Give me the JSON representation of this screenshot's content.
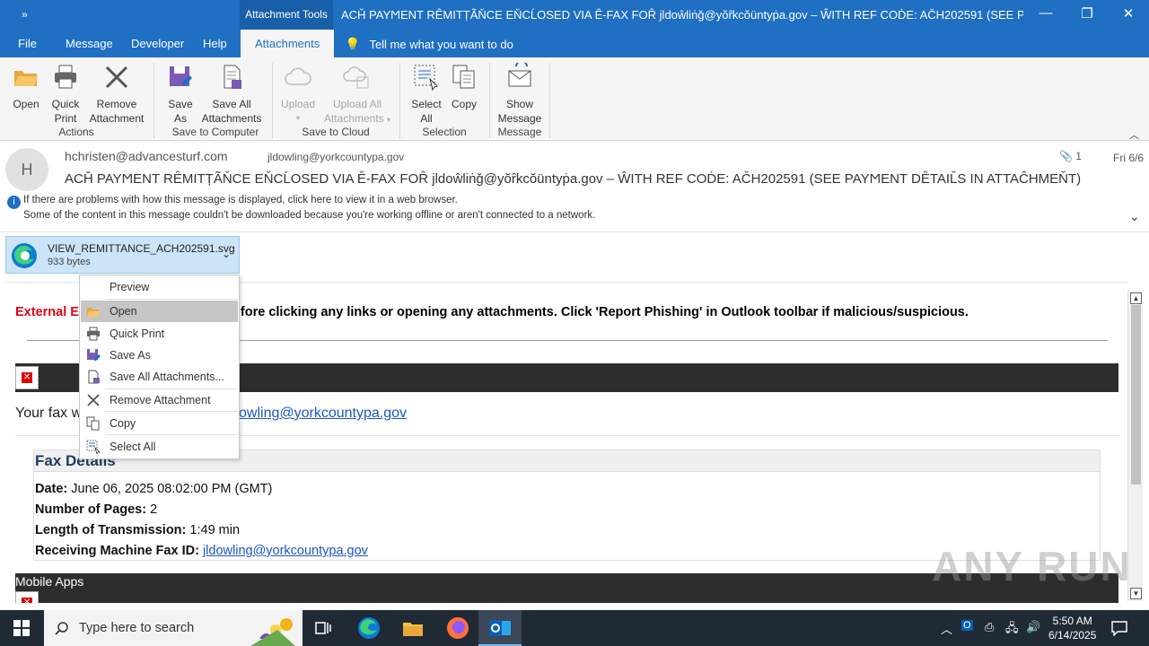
{
  "titlebar": {
    "quick_access": "»",
    "tool_tab": "Attachment Tools",
    "title": "ACȞ PAYϺENT RȆMITȚÃN̆CE EN̆CĹOSED VIA Ȇ-FAX FOȒ jldoŵliṅǧ@yŏȓkcŏüntyṗa.gov – ŴITH REF COḊE: AC̆H202591 (SEE PAYϺENT DȆTAIL̆S IN ATTAĈHMEN̆T)",
    "title_visible": "ACȞ PAYϺENT RȆMITȚÃN̆CE EN̆CĹOSED VIA Ȇ-FAX FOȒ jldoŵliṅǧ@yŏȓkcŏüntyṗa.gov – ŴITH REF COḊE: AC̆H202591 (SEE PAYϺENT DȆTAIL...",
    "minimize": "—",
    "restore": "❐",
    "close": "✕"
  },
  "tabs": {
    "file": "File",
    "message": "Message",
    "developer": "Developer",
    "help": "Help",
    "attachments": "Attachments",
    "tell_me": "Tell me what you want to do"
  },
  "ribbon": {
    "open": "Open",
    "quick_print_1": "Quick",
    "quick_print_2": "Print",
    "remove_1": "Remove",
    "remove_2": "Attachment",
    "group_actions": "Actions",
    "save_as_1": "Save",
    "save_as_2": "As",
    "save_all_1": "Save All",
    "save_all_2": "Attachments",
    "group_save_computer": "Save to Computer",
    "upload": "Upload",
    "upload_all_1": "Upload All",
    "upload_all_2": "Attachments",
    "group_save_cloud": "Save to Cloud",
    "select_all_1": "Select",
    "select_all_2": "All",
    "copy": "Copy",
    "group_selection": "Selection",
    "show_msg_1": "Show",
    "show_msg_2": "Message",
    "group_message": "Message"
  },
  "header": {
    "avatar_letter": "H",
    "from": "hchristen@advancesturf.com",
    "to": "jldowling@yorkcountypa.gov",
    "attachment_count": "1",
    "date": "Fri 6/6",
    "subject": "ACȞ PAYϺENT RȆMITȚÃN̆CE EN̆CĹOSED VIA Ȇ-FAX FOȒ jldoŵliṅǧ@yŏȓkcŏüntyṗa.gov – ŴITH REF COḊE: AC̆H202591 (SEE PAYϺENT DȆTAIL̆S IN ATTAĈHMEN̆T)",
    "info_line1": "If there are problems with how this message is displayed, click here to view it in a web browser.",
    "info_line2": "Some of the content in this message couldn't be downloaded because you're working offline or aren't connected to a network."
  },
  "attachment": {
    "name": "VIEW_REMITTANCE_ACH202591.svg",
    "size": "933 bytes"
  },
  "context_menu": {
    "preview": "Preview",
    "open": "Open",
    "quick_print": "Quick Print",
    "save_as": "Save As",
    "save_all": "Save All Attachments...",
    "remove": "Remove Attachment",
    "copy": "Copy",
    "select_all": "Select All"
  },
  "body": {
    "external_label": "External E",
    "external_rest": "fore clicking any links or opening any attachments. Click 'Report Phishing' in Outlook toolbar if malicious/suspicious.",
    "your_fax": "Your fax w",
    "your_fax_link": "dowling@yorkcountypa.gov",
    "fax_details_title": "Fax Details",
    "date_label": "Date:",
    "date_value": "June 06, 2025 08:02:00 PM (GMT)",
    "pages_label": "Number of Pages:",
    "pages_value": "2",
    "length_label": "Length of Transmission:",
    "length_value": "1:49 min",
    "machine_label": "Receiving Machine Fax ID:",
    "machine_value": "jldowling@yorkcountypa.gov",
    "mobile_apps": "Mobile Apps"
  },
  "watermark": "ANY RUN",
  "taskbar": {
    "search_placeholder": "Type here to search",
    "time": "5:50 AM",
    "date": "6/14/2025"
  }
}
